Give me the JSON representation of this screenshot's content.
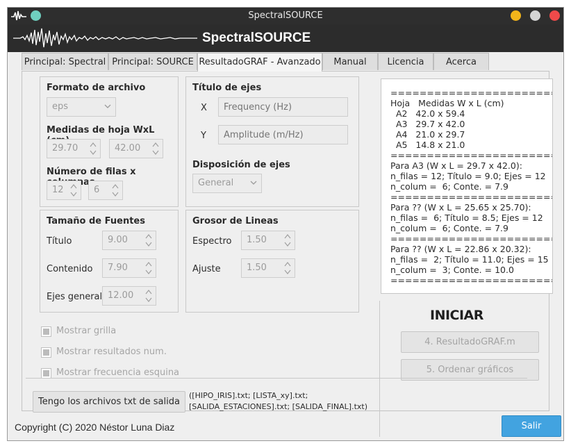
{
  "window": {
    "title": "SpectralSOURCE",
    "controls": {
      "minimize_color": "#f2b51b",
      "maximize_color": "#d4d4d4",
      "close_color": "#ef4a4a"
    }
  },
  "banner": {
    "brand": "SpectralSOURCE",
    "logo_icon": "seismogram-waveform"
  },
  "tabs": [
    {
      "label": "Principal: Spectral",
      "active": false
    },
    {
      "label": "Principal: SOURCE",
      "active": false
    },
    {
      "label": "ResultadoGRAF - Avanzado",
      "active": true
    },
    {
      "label": "Manual",
      "active": false
    },
    {
      "label": "Licencia",
      "active": false
    },
    {
      "label": "Acerca",
      "active": false
    }
  ],
  "formato": {
    "title": "Formato de archivo",
    "format_value": "eps",
    "size_title": "Medidas de hoja WxL (cm)",
    "width_value": "29.70",
    "height_value": "42.00",
    "grid_title": "Número de filas x columnas",
    "rows_value": "12",
    "cols_value": "6"
  },
  "titulo_ejes": {
    "title": "Título de ejes",
    "x_label": "X",
    "x_placeholder": "Frequency (Hz)",
    "y_label": "Y",
    "y_placeholder": "Amplitude (m/Hz)",
    "disp_title": "Disposición de ejes",
    "disp_value": "General"
  },
  "fuentes": {
    "title": "Tamaño de Fuentes",
    "titulo_label": "Título",
    "titulo_value": "9.00",
    "contenido_label": "Contenido",
    "contenido_value": "7.90",
    "ejes_label": "Ejes general",
    "ejes_value": "12.00"
  },
  "grosor": {
    "title": "Grosor de Lineas",
    "espectro_label": "Espectro",
    "espectro_value": "1.50",
    "ajuste_label": "Ajuste",
    "ajuste_value": "1.50"
  },
  "checks": {
    "grilla": "Mostrar grilla",
    "resultados": "Mostrar resultados num.",
    "frecuencia": "Mostrar frecuencia esquina"
  },
  "info_text": "==================================\nHoja   Medidas W x L (cm)\n  A2   42.0 x 59.4\n  A3   29.7 x 42.0\n  A4   21.0 x 29.7\n  A5   14.8 x 21.0\n==================================\nPara A3 (W x L = 29.7 x 42.0):\nn_filas = 12; Título = 9.0; Ejes = 12\nn_colum =  6; Conte. = 7.9\n==================================\nPara ?? (W x L = 25.65 x 25.70):\nn_filas =  6; Título = 8.5; Ejes = 12\nn_colum =  6; Conte. = 7.9\n==================================\nPara ?? (W x L = 22.86 x 20.32):\nn_filas =  2; Título = 11.0; Ejes = 15\nn_colum =  3; Conte. = 10.0\n==================================",
  "actions": {
    "iniciar": "INICIAR",
    "btn_resultado": "4. ResultadoGRAF.m",
    "btn_ordenar": "5. Ordenar gráficos"
  },
  "bottom": {
    "tengo_button": "Tengo los archivos txt de salida",
    "files_line1": "([HIPO_IRIS].txt; [LISTA_xy].txt;",
    "files_line2": "[SALIDA_ESTACIONES].txt; [SALIDA_FINAL].txt)"
  },
  "footer": {
    "copyright": "Copyright (C) 2020 Néstor Luna Diaz",
    "salir": "Salir",
    "salir_color": "#42a3e0"
  }
}
